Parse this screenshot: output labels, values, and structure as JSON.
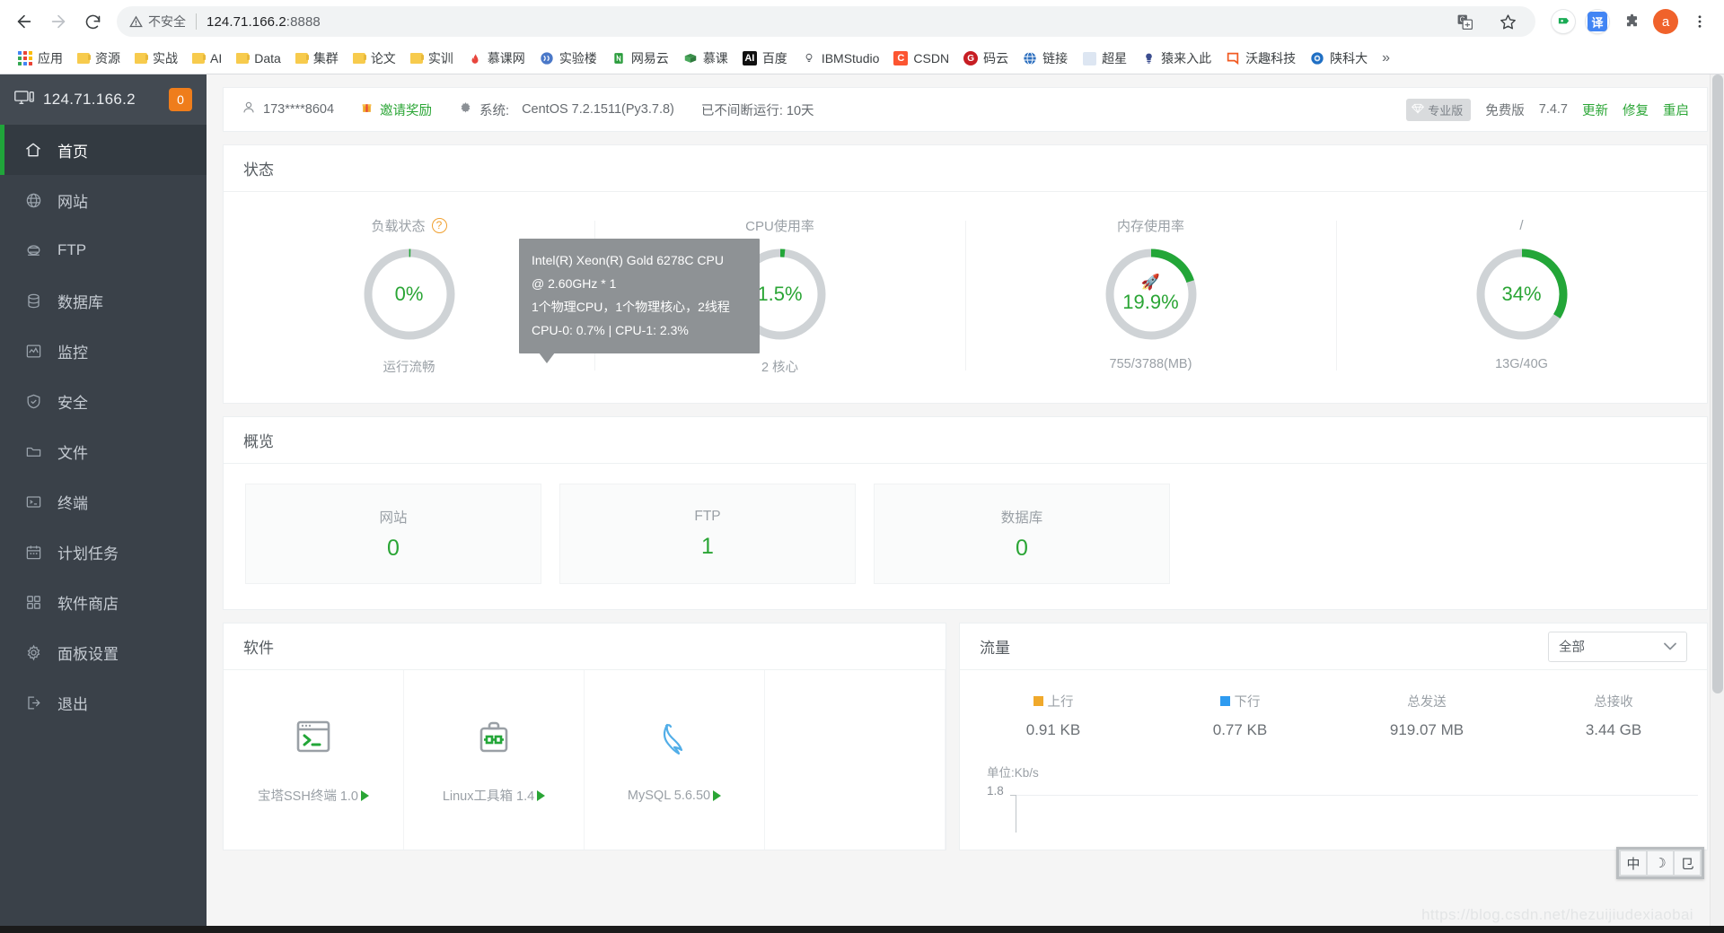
{
  "browser": {
    "security_label": "不安全",
    "url_host": "124.71.166.2",
    "url_port": ":8888",
    "back_icon": "back-arrow-icon",
    "forward_icon": "forward-arrow-icon",
    "reload_icon": "reload-icon",
    "translate_icon": "google-translate-icon",
    "bookmark_icon": "star-icon",
    "extension_icon": "puzzle-icon",
    "menu_icon": "three-dot-menu-icon",
    "profile_initial": "a",
    "translate_ext_label": "译",
    "overflow_label": "»"
  },
  "bookmarks": [
    {
      "label": "应用",
      "icon": "apps-grid-icon",
      "color": ""
    },
    {
      "label": "资源",
      "icon": "folder-icon",
      "color": "#f7cb4d"
    },
    {
      "label": "实战",
      "icon": "folder-icon",
      "color": "#f7cb4d"
    },
    {
      "label": "AI",
      "icon": "folder-icon",
      "color": "#f7cb4d"
    },
    {
      "label": "Data",
      "icon": "folder-icon",
      "color": "#f7cb4d"
    },
    {
      "label": "集群",
      "icon": "folder-icon",
      "color": "#f7cb4d"
    },
    {
      "label": "论文",
      "icon": "folder-icon",
      "color": "#f7cb4d"
    },
    {
      "label": "实训",
      "icon": "folder-icon",
      "color": "#f7cb4d"
    },
    {
      "label": "慕课网",
      "icon": "flame-icon",
      "color": "#e8453c"
    },
    {
      "label": "实验楼",
      "icon": "shiyanlou-icon",
      "color": "#4a78c8"
    },
    {
      "label": "网易云",
      "icon": "netease-icon",
      "color": "#2a9c3c"
    },
    {
      "label": "慕课",
      "icon": "imooc-icon",
      "color": "#3a8f4a"
    },
    {
      "label": "百度",
      "icon": "baidu-ai-icon",
      "color": "#111111"
    },
    {
      "label": "IBMStudio",
      "icon": "ibm-studio-icon",
      "color": "#6b6b6b"
    },
    {
      "label": "CSDN",
      "icon": "csdn-icon",
      "color": "#fc5531"
    },
    {
      "label": "码云",
      "icon": "gitee-icon",
      "color": "#c71d23"
    },
    {
      "label": "链接",
      "icon": "globe-icon",
      "color": "#2d6fbf"
    },
    {
      "label": "超星",
      "icon": "chaoxing-icon",
      "color": "#dde6f2"
    },
    {
      "label": "猿来入此",
      "icon": "bulb-icon",
      "color": "#3b4d8f"
    },
    {
      "label": "沃趣科技",
      "icon": "woqu-icon",
      "color": "#f15a22"
    },
    {
      "label": "陕科大",
      "icon": "sust-icon",
      "color": "#1f6fc4"
    }
  ],
  "sidebar": {
    "host": "124.71.166.2",
    "badge": "0",
    "monitor_icon": "monitor-icon",
    "items": [
      {
        "label": "首页",
        "icon": "home-icon",
        "active": true
      },
      {
        "label": "网站",
        "icon": "globe-icon",
        "active": false
      },
      {
        "label": "FTP",
        "icon": "ftp-icon",
        "active": false
      },
      {
        "label": "数据库",
        "icon": "database-icon",
        "active": false
      },
      {
        "label": "监控",
        "icon": "monitor-chart-icon",
        "active": false
      },
      {
        "label": "安全",
        "icon": "shield-check-icon",
        "active": false
      },
      {
        "label": "文件",
        "icon": "folder-icon",
        "active": false
      },
      {
        "label": "终端",
        "icon": "terminal-icon",
        "active": false
      },
      {
        "label": "计划任务",
        "icon": "calendar-icon",
        "active": false
      },
      {
        "label": "软件商店",
        "icon": "grid-apps-icon",
        "active": false
      },
      {
        "label": "面板设置",
        "icon": "gear-icon",
        "active": false
      },
      {
        "label": "退出",
        "icon": "logout-icon",
        "active": false
      }
    ]
  },
  "infobar": {
    "user_icon": "user-icon",
    "phone": "173****8604",
    "invite_icon": "gift-icon",
    "invite_label": "邀请奖励",
    "system_icon": "gear-icon",
    "system_label": "系统:",
    "system_value": "CentOS 7.2.1511(Py3.7.8)",
    "uptime": "已不间断运行: 10天",
    "pro_badge": "专业版",
    "pro_badge_icon": "diamond-icon",
    "edition": "免费版",
    "version": "7.4.7",
    "update_label": "更新",
    "repair_label": "修复",
    "restart_label": "重启"
  },
  "status": {
    "title": "状态",
    "gauges": [
      {
        "title": "负载状态",
        "has_help": true,
        "value": "0%",
        "percent": 0,
        "sub": "运行流畅",
        "icon": ""
      },
      {
        "title": "CPU使用率",
        "has_help": false,
        "value": "1.5%",
        "percent": 1.5,
        "sub": "2 核心",
        "icon": ""
      },
      {
        "title": "内存使用率",
        "has_help": false,
        "value": "19.9%",
        "percent": 19.9,
        "sub": "755/3788(MB)",
        "icon": "rocket-icon"
      },
      {
        "title": "/",
        "has_help": false,
        "value": "34%",
        "percent": 34,
        "sub": "13G/40G",
        "icon": ""
      }
    ]
  },
  "tooltip": {
    "line1": "Intel(R) Xeon(R) Gold 6278C CPU",
    "line2": "@ 2.60GHz * 1",
    "line3": "1个物理CPU，1个物理核心，2线程",
    "line4": "CPU-0: 0.7% | CPU-1: 2.3%"
  },
  "overview": {
    "title": "概览",
    "tiles": [
      {
        "name": "网站",
        "count": "0"
      },
      {
        "name": "FTP",
        "count": "1"
      },
      {
        "name": "数据库",
        "count": "0"
      }
    ]
  },
  "software": {
    "title": "软件",
    "items": [
      {
        "name": "宝塔SSH终端 1.0",
        "icon": "terminal-icon"
      },
      {
        "name": "Linux工具箱 1.4",
        "icon": "toolbox-icon"
      },
      {
        "name": "MySQL 5.6.50",
        "icon": "mysql-dolphin-icon"
      }
    ]
  },
  "traffic": {
    "title": "流量",
    "filter_value": "全部",
    "filter_chevron": "chevron-down-icon",
    "stats": [
      {
        "label": "上行",
        "value": "0.91 KB",
        "swatch": "#f0a92b"
      },
      {
        "label": "下行",
        "value": "0.77 KB",
        "swatch": "#2e9bf0"
      },
      {
        "label": "总发送",
        "value": "919.07 MB",
        "swatch": ""
      },
      {
        "label": "总接收",
        "value": "3.44 GB",
        "swatch": ""
      }
    ],
    "chart_unit": "单位:Kb/s",
    "y_top_tick": "1.8"
  },
  "chart_data": {
    "type": "line",
    "title": "流量",
    "subtitle": "单位:Kb/s",
    "xlabel": "",
    "ylabel": "Kb/s",
    "ylim": [
      0,
      1.8
    ],
    "yticks": [
      "1.8"
    ],
    "grid": true,
    "legend_position": "top",
    "series": [
      {
        "name": "上行",
        "color": "#f0a92b",
        "current": 0.91,
        "unit": "KB",
        "values": []
      },
      {
        "name": "下行",
        "color": "#2e9bf0",
        "current": 0.77,
        "unit": "KB",
        "values": []
      }
    ],
    "totals": [
      {
        "name": "总发送",
        "value": 919.07,
        "unit": "MB"
      },
      {
        "name": "总接收",
        "value": 3.44,
        "unit": "GB"
      }
    ]
  },
  "ime": {
    "keys": [
      "中",
      "☽",
      "⺋"
    ]
  },
  "watermark": "https://blog.csdn.net/hezuijiudexiaobai"
}
